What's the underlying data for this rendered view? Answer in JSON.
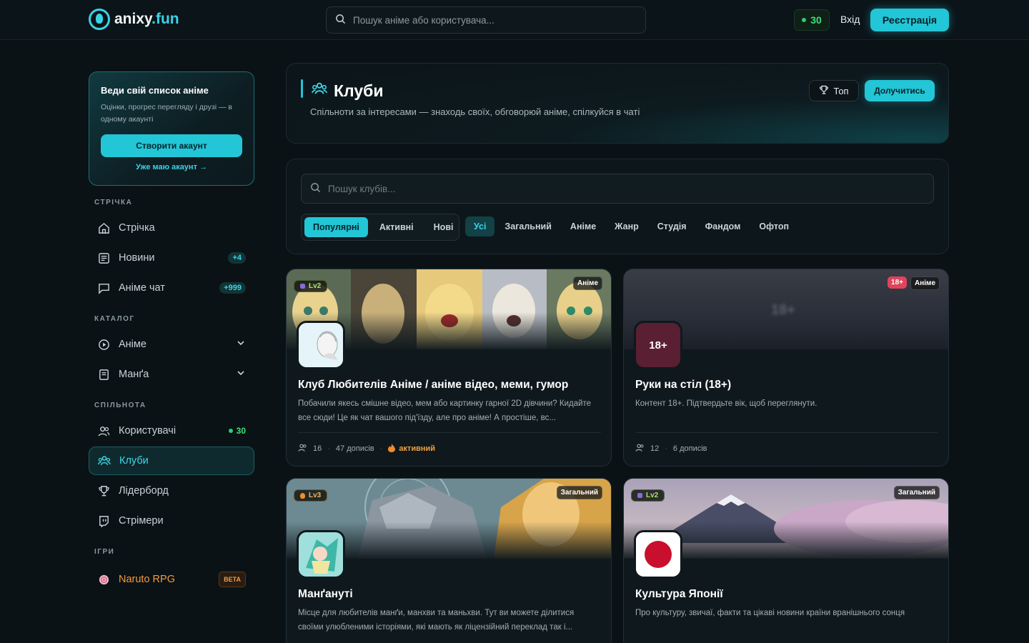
{
  "topbar": {
    "logo_main": "anixy",
    "logo_tld": ".fun",
    "search_placeholder": "Пошук аніме або користувача...",
    "coins": "30",
    "login": "Вхід",
    "register": "Реєстрація"
  },
  "promo": {
    "title": "Веди свій список аніме",
    "text": "Оцінки, прогрес перегляду і друзі — в одному акаунті",
    "cta": "Створити акаунт",
    "link": "Уже маю акаунт →"
  },
  "sidebar": {
    "sections": {
      "feed": "СТРІЧКА",
      "catalog": "КАТАЛОГ",
      "community": "СПІЛЬНОТА",
      "games": "ІГРИ"
    },
    "items": [
      {
        "label": "Стрічка",
        "icon": "home-icon"
      },
      {
        "label": "Новини",
        "icon": "news-icon",
        "badge": "+4"
      },
      {
        "label": "Аніме чат",
        "icon": "chat-icon",
        "badge": "+999"
      },
      {
        "label": "Аніме",
        "icon": "play-circle-icon"
      },
      {
        "label": "Манґа",
        "icon": "book-icon"
      },
      {
        "label": "Користувачі",
        "icon": "users-icon",
        "count": "30"
      },
      {
        "label": "Клуби",
        "icon": "clubs-icon"
      },
      {
        "label": "Лідерборд",
        "icon": "trophy-icon"
      },
      {
        "label": "Стрімери",
        "icon": "twitch-icon"
      },
      {
        "label": "Naruto RPG",
        "icon": "naruto-icon",
        "badge": "BETA"
      }
    ]
  },
  "page": {
    "title": "Клуби",
    "subtitle": "Спільноти за інтересами — знаходь своїх, обговорюй аніме, спілкуйся в чаті",
    "top_button": "Топ",
    "join_button": "Долучитись"
  },
  "filters": {
    "search_placeholder": "Пошук клубів...",
    "sort": [
      "Популярні",
      "Активні",
      "Нові"
    ],
    "categories": [
      "Усі",
      "Загальний",
      "Аніме",
      "Жанр",
      "Студія",
      "Фандом",
      "Офтоп"
    ]
  },
  "clubs": [
    {
      "title": "Клуб Любителів Аніме / аніме відео, меми, гумор",
      "description": "Побачили якесь смішне відео, мем або картинку гарної 2D дівчини? Кидайте все сюди! Це як чат вашого під'їзду, але про аніме! А простіше, вс...",
      "tag": "Аніме",
      "level": "Lv2",
      "members": "16",
      "posts": "47 дописів",
      "status": "активний"
    },
    {
      "title": "Руки на стіл (18+)",
      "description": "Контент 18+. Підтвердьте вік, щоб переглянути.",
      "tag": "Аніме",
      "age": "18+",
      "avatar_text": "18+",
      "banner_text": "18+",
      "members": "12",
      "posts": "6 дописів"
    },
    {
      "title": "Манґануті",
      "description": "Місце для любителів манґи, манхви та маньхви. Тут ви можете ділитися своїми улюбленими історіями, які мають як ліцензійний переклад так і...",
      "tag": "Загальний",
      "level": "Lv3"
    },
    {
      "title": "Культура Японії",
      "description": "Про культуру, звичаї, факти та цікаві новини країни вранішнього сонця",
      "tag": "Загальний",
      "level": "Lv2"
    }
  ],
  "colors": {
    "accent": "#22c6d6",
    "background": "#0a1216",
    "active_green": "#3ee07a",
    "warning": "#f0a042"
  }
}
